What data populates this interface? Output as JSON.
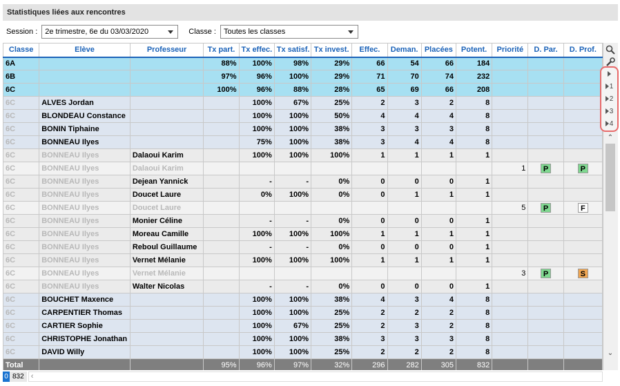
{
  "title": "Statistiques liées aux rencontres",
  "filters": {
    "session_label": "Session :",
    "session_value": "2e trimestre, 6e du 03/03/2020",
    "classe_label": "Classe :",
    "classe_value": "Toutes les classes"
  },
  "columns": [
    "Classe",
    "Elève",
    "Professeur",
    "Tx part.",
    "Tx effec.",
    "Tx satisf.",
    "Tx invest.",
    "Effec.",
    "Deman.",
    "Placées",
    "Potent.",
    "Priorité",
    "D. Par.",
    "D. Prof."
  ],
  "rows": [
    {
      "type": "hl",
      "c": [
        "6A",
        "",
        "",
        "88%",
        "100%",
        "98%",
        "29%",
        "66",
        "54",
        "66",
        "184",
        "",
        "",
        ""
      ]
    },
    {
      "type": "hl",
      "c": [
        "6B",
        "",
        "",
        "97%",
        "96%",
        "100%",
        "29%",
        "71",
        "70",
        "74",
        "232",
        "",
        "",
        ""
      ]
    },
    {
      "type": "hl",
      "c": [
        "6C",
        "",
        "",
        "100%",
        "96%",
        "88%",
        "28%",
        "65",
        "69",
        "66",
        "208",
        "",
        "",
        ""
      ]
    },
    {
      "type": "norm",
      "c": [
        "6C",
        "ALVES Jordan",
        "",
        "",
        "100%",
        "67%",
        "25%",
        "2",
        "3",
        "2",
        "8",
        "",
        "",
        ""
      ]
    },
    {
      "type": "norm",
      "c": [
        "6C",
        "BLONDEAU Constance",
        "",
        "",
        "100%",
        "100%",
        "50%",
        "4",
        "4",
        "4",
        "8",
        "",
        "",
        ""
      ]
    },
    {
      "type": "norm",
      "c": [
        "6C",
        "BONIN Tiphaine",
        "",
        "",
        "100%",
        "100%",
        "38%",
        "3",
        "3",
        "3",
        "8",
        "",
        "",
        ""
      ]
    },
    {
      "type": "norm",
      "c": [
        "6C",
        "BONNEAU Ilyes",
        "",
        "",
        "75%",
        "100%",
        "38%",
        "3",
        "4",
        "4",
        "8",
        "",
        "",
        ""
      ]
    },
    {
      "type": "sub",
      "c": [
        "6C",
        "BONNEAU Ilyes",
        "Dalaoui Karim",
        "",
        "100%",
        "100%",
        "100%",
        "1",
        "1",
        "1",
        "1",
        "",
        "",
        ""
      ]
    },
    {
      "type": "gray",
      "c": [
        "6C",
        "BONNEAU Ilyes",
        "Dalaoui Karim",
        "",
        "",
        "",
        "",
        "",
        "",
        "",
        "",
        "1",
        "P",
        "P"
      ]
    },
    {
      "type": "sub",
      "c": [
        "6C",
        "BONNEAU Ilyes",
        "Dejean Yannick",
        "",
        "-",
        "-",
        "0%",
        "0",
        "0",
        "0",
        "1",
        "",
        "",
        ""
      ]
    },
    {
      "type": "sub",
      "c": [
        "6C",
        "BONNEAU Ilyes",
        "Doucet Laure",
        "",
        "0%",
        "100%",
        "0%",
        "0",
        "1",
        "1",
        "1",
        "",
        "",
        ""
      ]
    },
    {
      "type": "gray",
      "c": [
        "6C",
        "BONNEAU Ilyes",
        "Doucet Laure",
        "",
        "",
        "",
        "",
        "",
        "",
        "",
        "",
        "5",
        "P",
        "F"
      ]
    },
    {
      "type": "sub",
      "c": [
        "6C",
        "BONNEAU Ilyes",
        "Monier Céline",
        "",
        "-",
        "-",
        "0%",
        "0",
        "0",
        "0",
        "1",
        "",
        "",
        ""
      ]
    },
    {
      "type": "sub",
      "c": [
        "6C",
        "BONNEAU Ilyes",
        "Moreau Camille",
        "",
        "100%",
        "100%",
        "100%",
        "1",
        "1",
        "1",
        "1",
        "",
        "",
        ""
      ]
    },
    {
      "type": "sub",
      "c": [
        "6C",
        "BONNEAU Ilyes",
        "Reboul Guillaume",
        "",
        "-",
        "-",
        "0%",
        "0",
        "0",
        "0",
        "1",
        "",
        "",
        ""
      ]
    },
    {
      "type": "sub",
      "c": [
        "6C",
        "BONNEAU Ilyes",
        "Vernet Mélanie",
        "",
        "100%",
        "100%",
        "100%",
        "1",
        "1",
        "1",
        "1",
        "",
        "",
        ""
      ]
    },
    {
      "type": "gray",
      "c": [
        "6C",
        "BONNEAU Ilyes",
        "Vernet Mélanie",
        "",
        "",
        "",
        "",
        "",
        "",
        "",
        "",
        "3",
        "P",
        "S"
      ]
    },
    {
      "type": "sub",
      "c": [
        "6C",
        "BONNEAU Ilyes",
        "Walter Nicolas",
        "",
        "-",
        "-",
        "0%",
        "0",
        "0",
        "0",
        "1",
        "",
        "",
        ""
      ]
    },
    {
      "type": "norm",
      "c": [
        "6C",
        "BOUCHET Maxence",
        "",
        "",
        "100%",
        "100%",
        "38%",
        "4",
        "3",
        "4",
        "8",
        "",
        "",
        ""
      ]
    },
    {
      "type": "norm",
      "c": [
        "6C",
        "CARPENTIER Thomas",
        "",
        "",
        "100%",
        "100%",
        "25%",
        "2",
        "2",
        "2",
        "8",
        "",
        "",
        ""
      ]
    },
    {
      "type": "norm",
      "c": [
        "6C",
        "CARTIER Sophie",
        "",
        "",
        "100%",
        "67%",
        "25%",
        "2",
        "3",
        "2",
        "8",
        "",
        "",
        ""
      ]
    },
    {
      "type": "norm",
      "c": [
        "6C",
        "CHRISTOPHE Jonathan",
        "",
        "",
        "100%",
        "100%",
        "38%",
        "3",
        "3",
        "3",
        "8",
        "",
        "",
        ""
      ]
    },
    {
      "type": "norm",
      "c": [
        "6C",
        "DAVID Willy",
        "",
        "",
        "100%",
        "100%",
        "25%",
        "2",
        "2",
        "2",
        "8",
        "",
        "",
        ""
      ]
    }
  ],
  "total": [
    "Total",
    "",
    "",
    "95%",
    "96%",
    "97%",
    "32%",
    "296",
    "282",
    "305",
    "832",
    "",
    "",
    ""
  ],
  "levels": [
    "",
    "1",
    "2",
    "3",
    "4"
  ],
  "footer": {
    "selected": "0",
    "total": "832"
  }
}
